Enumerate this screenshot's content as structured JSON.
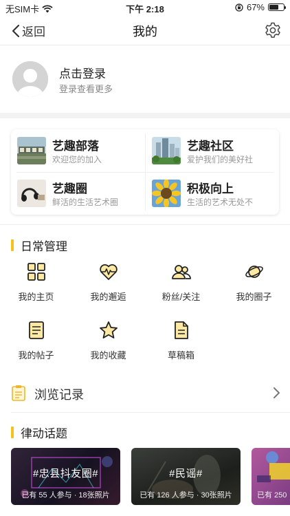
{
  "status_bar": {
    "carrier": "无SIM卡",
    "time": "下午 2:18",
    "battery": "67%",
    "battery_level": 0.67
  },
  "nav": {
    "back_label": "返回",
    "title": "我的"
  },
  "profile": {
    "login_title": "点击登录",
    "login_subtitle": "登录查看更多"
  },
  "community": [
    {
      "title": "艺趣部落",
      "subtitle": "欢迎您的加入"
    },
    {
      "title": "艺趣社区",
      "subtitle": "爱护我们的美好社"
    },
    {
      "title": "艺趣圈",
      "subtitle": "鲜活的生活艺术圈"
    },
    {
      "title": "积极向上",
      "subtitle": "生活的艺术无处不"
    }
  ],
  "daily_management": {
    "title": "日常管理",
    "items": [
      {
        "label": "我的主页",
        "icon": "grid-home-icon"
      },
      {
        "label": "我的邂逅",
        "icon": "heart-pulse-icon"
      },
      {
        "label": "粉丝/关注",
        "icon": "people-icon"
      },
      {
        "label": "我的圈子",
        "icon": "planet-icon"
      },
      {
        "label": "我的帖子",
        "icon": "document-list-icon"
      },
      {
        "label": "我的收藏",
        "icon": "star-icon"
      },
      {
        "label": "草稿箱",
        "icon": "draft-file-icon"
      }
    ]
  },
  "browse_history": {
    "label": "浏览记录"
  },
  "topics": {
    "title": "律动话题",
    "cards": [
      {
        "name": "#忠县抖友圈#",
        "meta": "已有 55 人参与 · 18张照片"
      },
      {
        "name": "#民谣#",
        "meta": "已有 126 人参与 · 30张照片"
      },
      {
        "name": "",
        "meta": "已有 250"
      }
    ]
  },
  "colors": {
    "accent": "#f4c21a",
    "icon_fill": "#fde9a3"
  }
}
